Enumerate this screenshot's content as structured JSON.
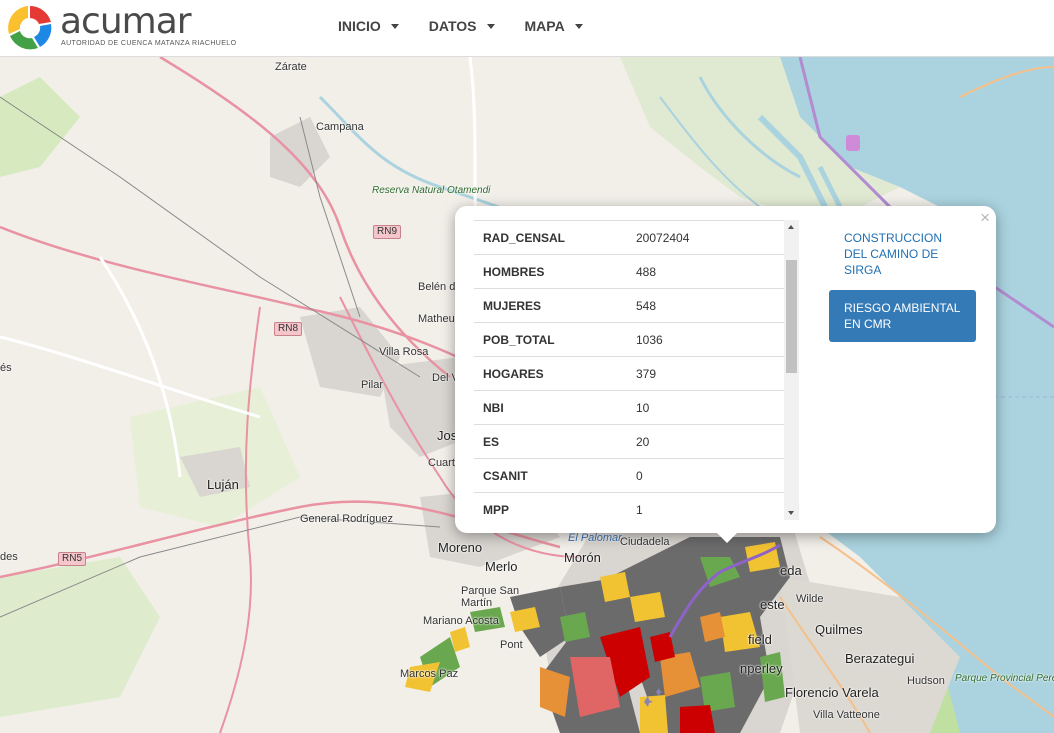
{
  "header": {
    "logo_name": "acumar",
    "logo_subtitle": "AUTORIDAD DE CUENCA MATANZA RIACHUELO",
    "nav": [
      {
        "label": "INICIO"
      },
      {
        "label": "DATOS"
      },
      {
        "label": "MAPA"
      }
    ]
  },
  "map": {
    "places": {
      "zarate": "Zárate",
      "campana": "Campana",
      "reserva": "Reserva Natural Otamendi",
      "belen": "Belén de",
      "matheu": "Matheu",
      "villa_rosa": "Villa Rosa",
      "pilar": "Pilar",
      "del_viso": "Del Vi",
      "jos": "Jos",
      "cuartel": "Cuarte",
      "lujan": "Luján",
      "general_rodriguez": "General Rodríguez",
      "moreno": "Moreno",
      "merlo": "Merlo",
      "moron": "Morón",
      "el_palomar": "El Palomar",
      "ciudadela": "Ciudadela",
      "parque_san_martin": "Parque San Martín",
      "mariano_acosta": "Mariano Acosta",
      "pont": "Pont",
      "marcos_paz": "Marcos Paz",
      "quilmes": "Quilmes",
      "berazategui": "Berazategui",
      "florencio_varela": "Florencio Varela",
      "villa_vatteone": "Villa Vatteone",
      "hudson": "Hudson",
      "wilde": "Wilde",
      "avellaneda": "eda",
      "lanus": "este",
      "banfield": "field",
      "temperley": "nperley",
      "parque_pereyra": "Parque Provincial Pereyra Iraola",
      "des": "des",
      "es": "és"
    },
    "routes": {
      "rn9": "RN9",
      "rn8": "RN8",
      "rn5": "RN5"
    },
    "colors": {
      "land": "#f2efe9",
      "water": "#aad3df",
      "urban": "#d9d5d0",
      "park": "#cfe8b4",
      "primary_road": "#e892a2",
      "census_gray": "#6b6b6b",
      "census_green": "#6aa84f",
      "census_yellow": "#f1c232",
      "census_orange": "#e69138",
      "census_red": "#cc0000",
      "river_purple": "#8e63c9"
    }
  },
  "popup": {
    "rows": [
      {
        "key": "RAD_CENSAL",
        "value": "20072404"
      },
      {
        "key": "HOMBRES",
        "value": "488"
      },
      {
        "key": "MUJERES",
        "value": "548"
      },
      {
        "key": "POB_TOTAL",
        "value": "1036"
      },
      {
        "key": "HOGARES",
        "value": "379"
      },
      {
        "key": "NBI",
        "value": "10"
      },
      {
        "key": "ES",
        "value": "20"
      },
      {
        "key": "CSANIT",
        "value": "0"
      },
      {
        "key": "MPP",
        "value": "1"
      }
    ],
    "link_label": "CONSTRUCCION DEL CAMINO DE SIRGA",
    "button_label": "RIESGO AMBIENTAL EN CMR",
    "close_label": "×"
  }
}
